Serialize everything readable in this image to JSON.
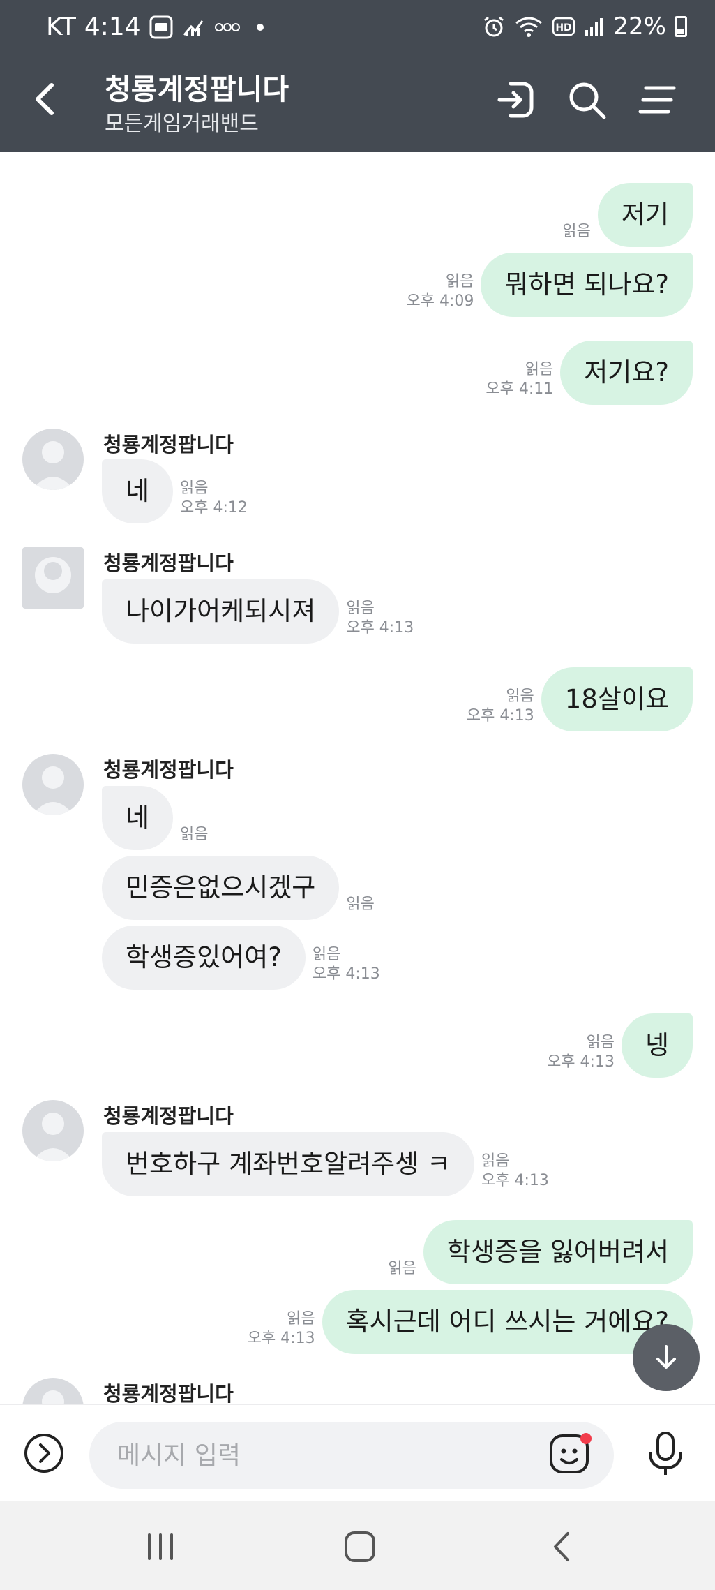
{
  "status_bar": {
    "carrier": "KT",
    "time": "4:14",
    "battery": "22%",
    "icons": [
      "app-badge-icon",
      "stats-icon",
      "more-dots-icon",
      "dot-icon",
      "alarm-icon",
      "wifi-icon",
      "hd-icon",
      "signal-icon",
      "battery-icon"
    ]
  },
  "header": {
    "title": "청룡계정팝니다",
    "subtitle": "모든게임거래밴드",
    "icons": [
      "back-icon",
      "enter-icon",
      "search-icon",
      "menu-icon"
    ]
  },
  "messages": [
    {
      "dir": "out",
      "text": "저기",
      "read": "읽음",
      "time": ""
    },
    {
      "dir": "out",
      "text": "뭐하면 되나요?",
      "read": "읽음",
      "time": "오후 4:09"
    },
    {
      "dir": "out",
      "text": "저기요?",
      "read": "읽음",
      "time": "오후 4:11"
    },
    {
      "dir": "in",
      "sender": "청룡계정팝니다",
      "text": "네",
      "read": "읽음",
      "time": "오후 4:12"
    },
    {
      "dir": "in",
      "sender": "청룡계정팝니다",
      "text": "나이가어케되시져",
      "read": "읽음",
      "time": "오후 4:13"
    },
    {
      "dir": "out",
      "text": "18살이요",
      "read": "읽음",
      "time": "오후 4:13"
    },
    {
      "dir": "in",
      "sender": "청룡계정팝니다",
      "text": "네",
      "read": "읽음",
      "time": ""
    },
    {
      "dir": "in",
      "text": "민증은없으시겠구",
      "read": "읽음",
      "time": ""
    },
    {
      "dir": "in",
      "text": "학생증있어여?",
      "read": "읽음",
      "time": "오후 4:13"
    },
    {
      "dir": "out",
      "text": "넹",
      "read": "읽음",
      "time": "오후 4:13"
    },
    {
      "dir": "in",
      "sender": "청룡계정팝니다",
      "text": "번호하구 계좌번호알려주셍 ㅋ",
      "read": "읽음",
      "time": "오후 4:13"
    },
    {
      "dir": "out",
      "text": "학생증을 잃어버려서",
      "read": "읽음",
      "time": ""
    },
    {
      "dir": "out",
      "text": "혹시근데 어디 쓰시는 거에요?",
      "read": "읽음",
      "time": "오후 4:13"
    },
    {
      "dir": "in",
      "sender": "청룡계정팝니다",
      "text": "",
      "read": "",
      "time": ""
    }
  ],
  "input": {
    "placeholder": "메시지 입력",
    "icons": [
      "expand-icon",
      "emoji-icon",
      "mic-icon"
    ]
  },
  "navbar": {
    "icons": [
      "recent-apps-icon",
      "home-icon",
      "back-nav-icon"
    ]
  },
  "colors": {
    "header_bg": "#444a52",
    "outgoing_bubble": "#d7f3e3",
    "incoming_bubble": "#eff0f2",
    "notification_dot": "#f23c4b"
  }
}
